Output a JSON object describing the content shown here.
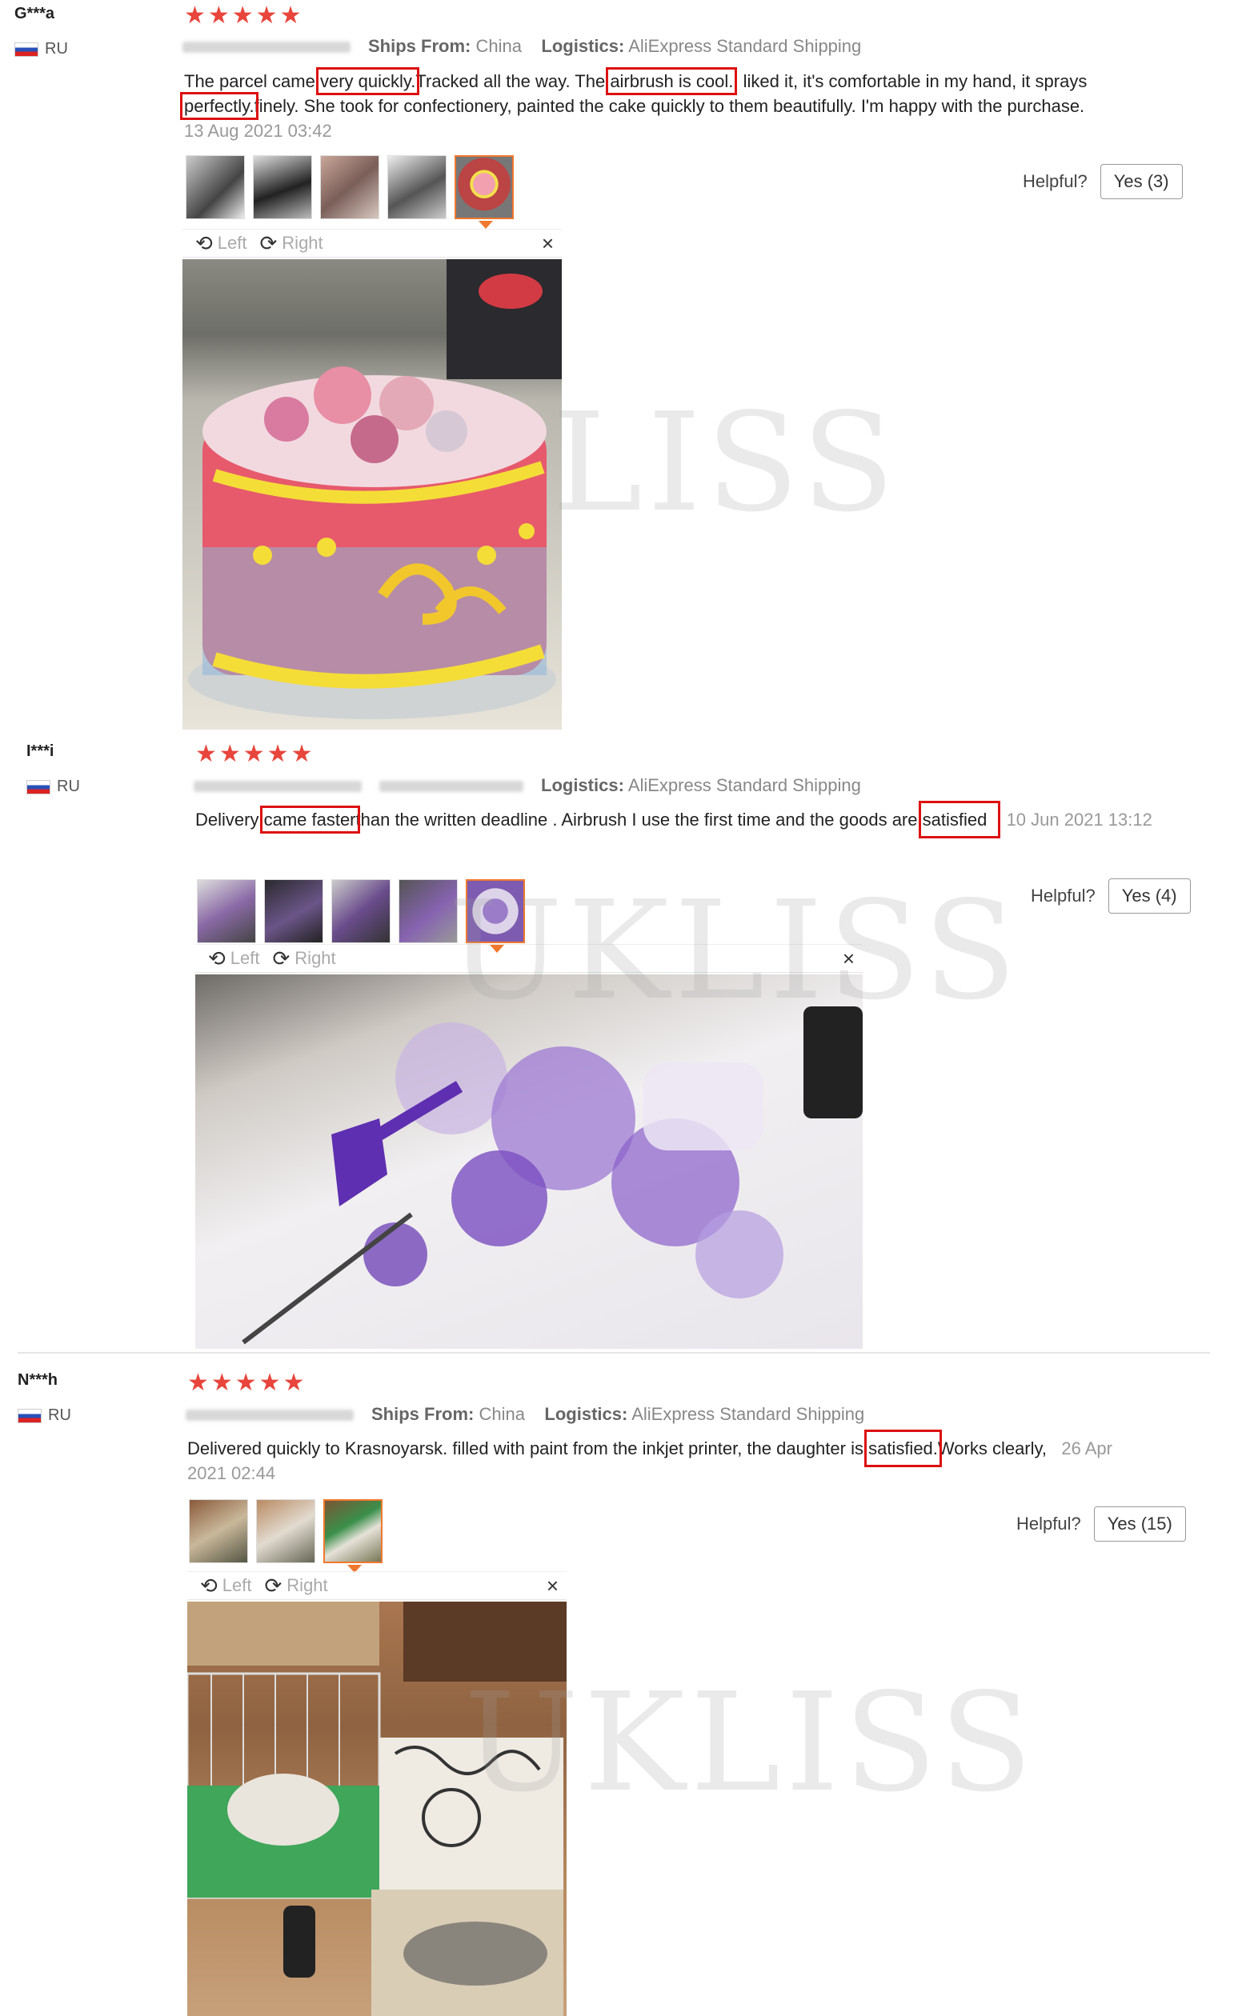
{
  "reviews": [
    {
      "user": "G***a",
      "country": "RU",
      "stars": "★★★★★",
      "ships_label": "Ships From:",
      "ships_value": "China",
      "logistics_label": "Logistics:",
      "logistics_value": "AliExpress Standard Shipping",
      "text_parts": [
        "The parcel came ",
        "very quickly.",
        "Tracked all the way. The ",
        "airbrush is cool.",
        "I liked it, it's comfortable in my hand, it sprays ",
        "perfectly.",
        "finely. She took for confectionery, painted the cake quickly to them beautifully. I'm happy with the purchase."
      ],
      "date": "13 Aug 2021 03:42",
      "helpful_label": "Helpful?",
      "yes_label": "Yes (3)",
      "rotate_left": "Left",
      "rotate_right": "Right",
      "close": "×"
    },
    {
      "user": "I***i",
      "country": "RU",
      "stars": "★★★★★",
      "logistics_label": "Logistics:",
      "logistics_value": "AliExpress Standard Shipping",
      "text_parts": [
        "Delivery ",
        "came faster",
        "than the written deadline . Airbrush I use the first time and the goods are ",
        "satisfied"
      ],
      "date": "10 Jun 2021 13:12",
      "helpful_label": "Helpful?",
      "yes_label": "Yes (4)",
      "rotate_left": "Left",
      "rotate_right": "Right",
      "close": "×"
    },
    {
      "user": "N***h",
      "country": "RU",
      "stars": "★★★★★",
      "ships_label": "Ships From:",
      "ships_value": "China",
      "logistics_label": "Logistics:",
      "logistics_value": "AliExpress Standard Shipping",
      "text_parts": [
        "Delivered quickly to Krasnoyarsk. filled with paint from the inkjet printer, the daughter is ",
        "satisfied.",
        "Works clearly, "
      ],
      "date": "26 Apr 2021 02:44",
      "helpful_label": "Helpful?",
      "yes_label": "Yes (15)",
      "rotate_left": "Left",
      "rotate_right": "Right",
      "close": "×"
    }
  ],
  "watermark": "LISS",
  "watermark2": "UKLISS",
  "colors": {
    "star": "#e8453c",
    "highlight": "#d11111",
    "selected_thumb": "#f0782d"
  }
}
